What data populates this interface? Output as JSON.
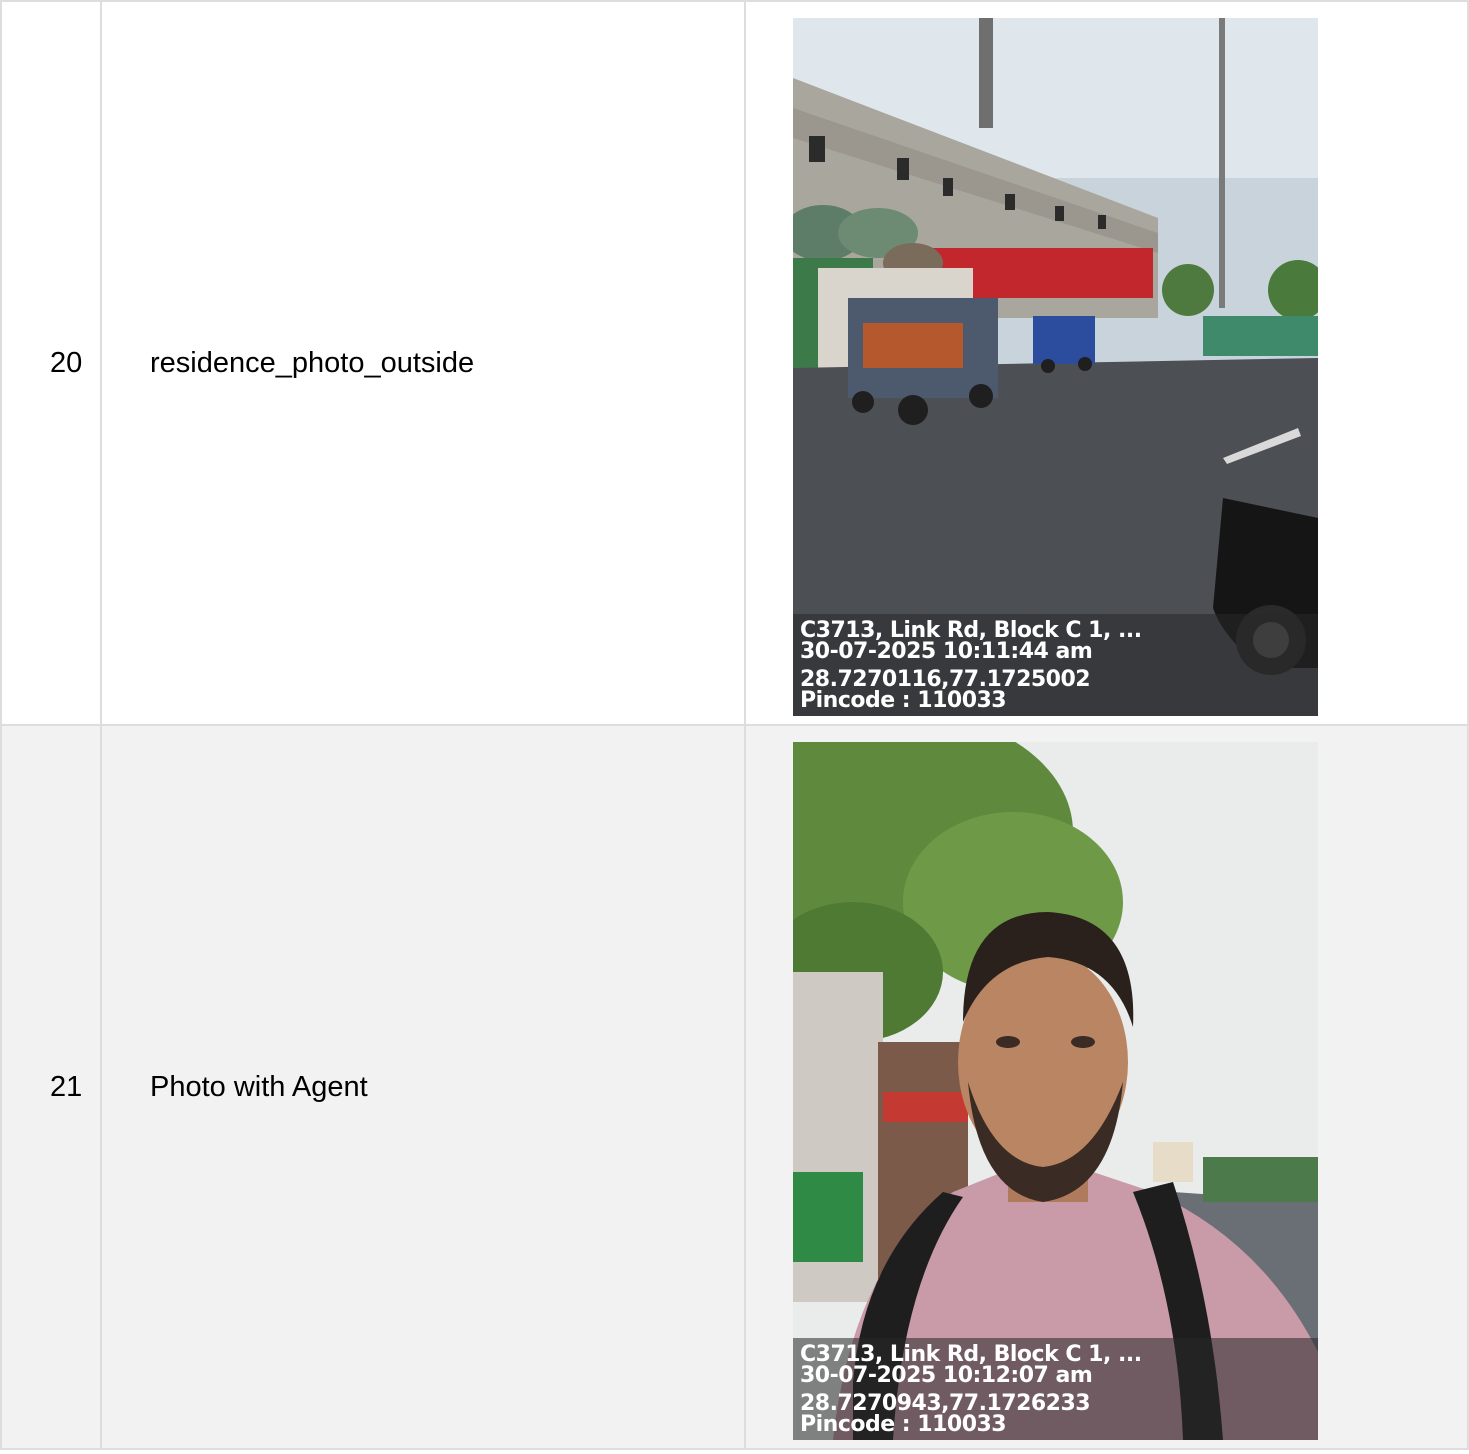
{
  "rows": [
    {
      "number": "20",
      "label": "residence_photo_outside",
      "photo": {
        "subject": "street scene with e-rickshaws, trucks and a concrete building",
        "stamp": {
          "address": "C3713, Link Rd, Block C 1, ...",
          "datetime": "30-07-2025 10:11:44 am",
          "coords": "28.7270116,77.1725002",
          "pincode": "Pincode : 110033"
        }
      }
    },
    {
      "number": "21",
      "label": "Photo with Agent",
      "photo": {
        "subject": "selfie of agent in pink striped shirt with backpack beside a road",
        "stamp": {
          "address": "C3713, Link Rd, Block C 1, ...",
          "datetime": "30-07-2025 10:12:07 am",
          "coords": "28.7270943,77.1726233",
          "pincode": "Pincode : 110033"
        }
      }
    }
  ]
}
